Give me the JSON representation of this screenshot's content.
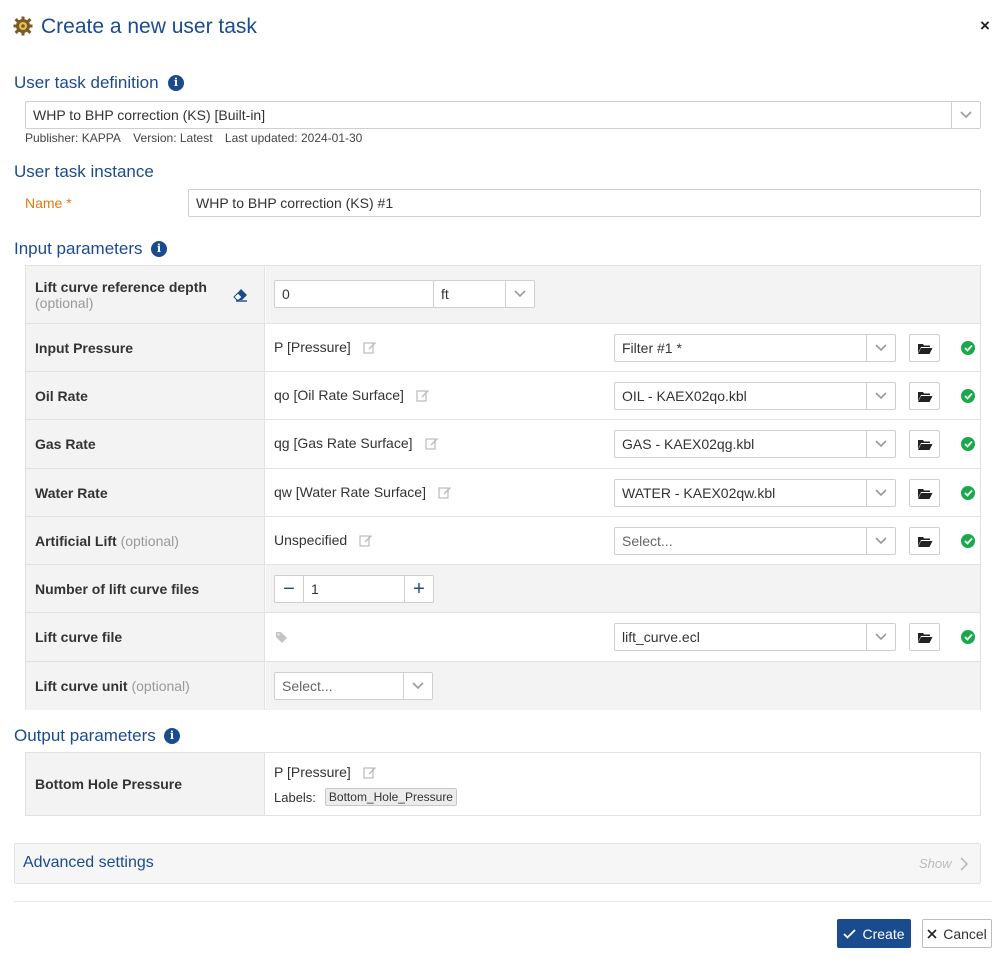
{
  "dialog": {
    "title": "Create a new user task",
    "close": "×"
  },
  "definition": {
    "title": "User task definition",
    "selected": "WHP to BHP correction (KS) [Built-in]",
    "publisher": "Publisher: KAPPA",
    "version": "Version: Latest",
    "updated": "Last updated: 2024-01-30"
  },
  "instance": {
    "title": "User task instance",
    "name_label": "Name",
    "required_mark": "*",
    "name_value": "WHP to BHP correction (KS) #1"
  },
  "input": {
    "title": "Input parameters",
    "rows": [
      {
        "label": "Lift curve reference depth",
        "optional": "(optional)",
        "value": "0",
        "unit": "ft"
      },
      {
        "label": "Input Pressure",
        "value": "P [Pressure]",
        "select": "Filter #1 *"
      },
      {
        "label": "Oil Rate",
        "value": "qo [Oil Rate Surface]",
        "select": "OIL - KAEX02qo.kbl"
      },
      {
        "label": "Gas Rate",
        "value": "qg [Gas Rate Surface]",
        "select": "GAS - KAEX02qg.kbl"
      },
      {
        "label": "Water Rate",
        "value": "qw [Water Rate Surface]",
        "select": "WATER - KAEX02qw.kbl"
      },
      {
        "label": "Artificial Lift",
        "optional": "(optional)",
        "value": "Unspecified",
        "select": "Select..."
      },
      {
        "label": "Number of lift curve files",
        "value": "1",
        "minus": "−",
        "plus": "+"
      },
      {
        "label": "Lift curve file",
        "select": "lift_curve.ecl"
      },
      {
        "label": "Lift curve unit",
        "optional": "(optional)",
        "select": "Select..."
      }
    ]
  },
  "output": {
    "title": "Output parameters",
    "label": "Bottom Hole Pressure",
    "value": "P [Pressure]",
    "labels_caption": "Labels:",
    "tag": "Bottom_Hole_Pressure"
  },
  "advanced": {
    "title": "Advanced settings",
    "show": "Show"
  },
  "footer": {
    "create": "Create",
    "cancel": "Cancel"
  }
}
